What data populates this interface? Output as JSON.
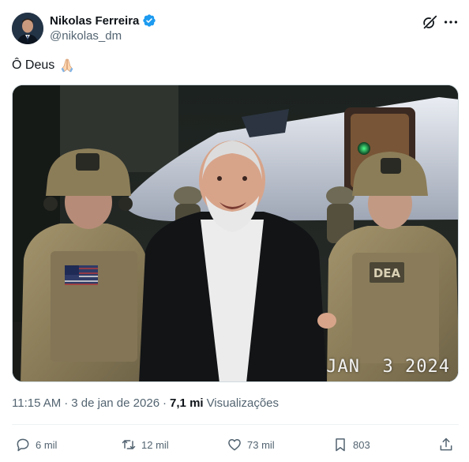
{
  "author": {
    "display_name": "Nikolas Ferreira",
    "handle": "@nikolas_dm",
    "verified": true
  },
  "tweet": {
    "text": "Ô Deus",
    "emoji": "folded-hands",
    "image_stamp": "JAN  3 2024"
  },
  "meta": {
    "time": "11:15 AM",
    "separator": "·",
    "date": "3 de jan de 2026",
    "views_count": "7,1 mi",
    "views_label": "Visualizações"
  },
  "actions": {
    "replies": "6 mil",
    "retweets": "12 mil",
    "likes": "73 mil",
    "bookmarks": "803"
  },
  "colors": {
    "verified_blue": "#1d9bf0",
    "secondary_text": "#536471",
    "primary_text": "#0f1419"
  },
  "icons": {
    "header": [
      "grok-icon",
      "more-icon"
    ],
    "actions": [
      "reply-icon",
      "retweet-icon",
      "like-icon",
      "bookmark-icon",
      "share-icon"
    ]
  }
}
